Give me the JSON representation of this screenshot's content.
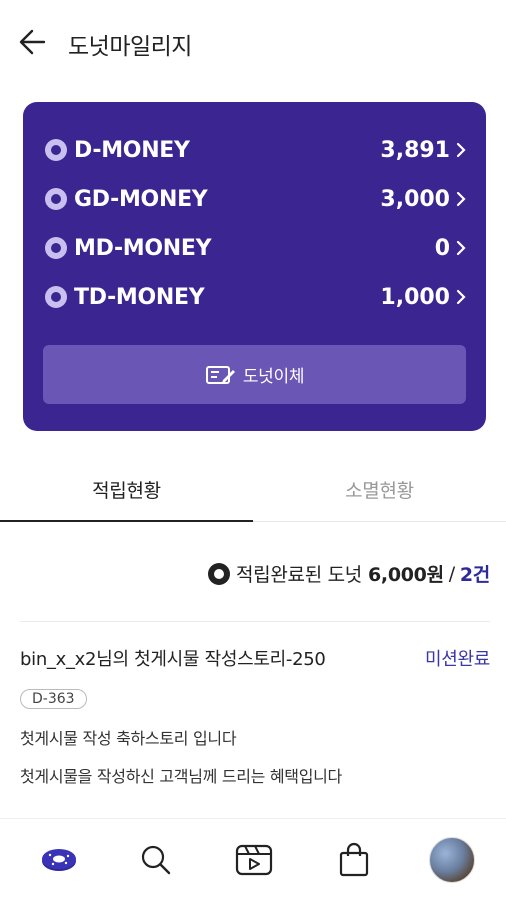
{
  "header": {
    "title": "도넛마일리지"
  },
  "money": [
    {
      "name": "D-MONEY",
      "amount": "3,891"
    },
    {
      "name": "GD-MONEY",
      "amount": "3,000"
    },
    {
      "name": "MD-MONEY",
      "amount": "0"
    },
    {
      "name": "TD-MONEY",
      "amount": "1,000"
    }
  ],
  "transfer": {
    "label": "도넛이체"
  },
  "tabs": [
    {
      "label": "적립현황",
      "active": true
    },
    {
      "label": "소멸현황",
      "active": false
    }
  ],
  "summary": {
    "label": "적립완료된 도넛",
    "amount": "6,000원",
    "separator": "/",
    "count": "2건"
  },
  "mission": {
    "title": "bin_x_x2님의 첫게시물 작성스토리-250",
    "status": "미션완료",
    "badge": "D-363",
    "desc1": "첫게시물 작성 축하스토리 입니다",
    "desc2": "첫게시물을 작성하신 고객님께 드리는 혜택입니다"
  },
  "nav": {
    "items": [
      "donut-icon",
      "search-icon",
      "video-icon",
      "shopping-bag-icon",
      "avatar"
    ]
  },
  "colors": {
    "card": "#3a2591",
    "transfer_button": "#6a56b4",
    "accent": "#2e2a9c"
  }
}
